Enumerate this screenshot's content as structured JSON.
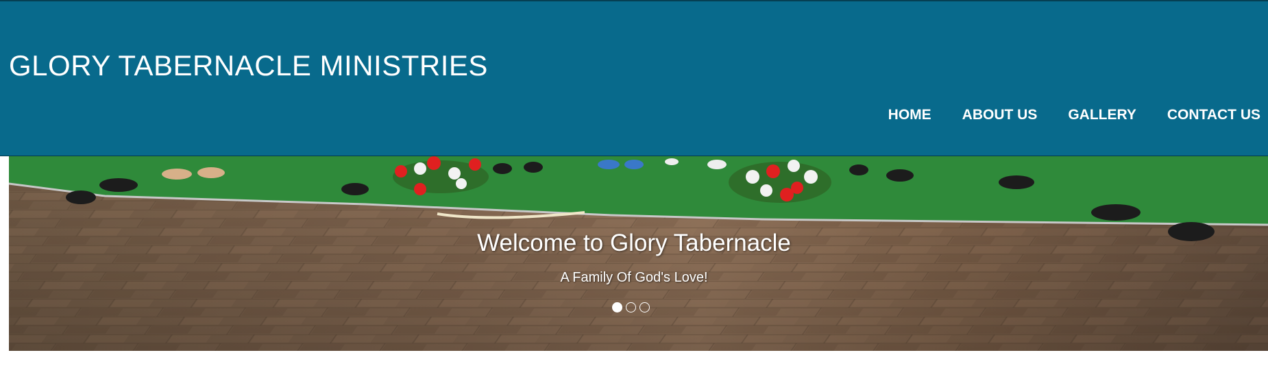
{
  "header": {
    "site_title": "GLORY TABERNACLE MINISTRIES",
    "background_color": "#086a8c",
    "nav": [
      {
        "label": "HOME"
      },
      {
        "label": "ABOUT US"
      },
      {
        "label": "GALLERY"
      },
      {
        "label": "CONTACT US"
      }
    ]
  },
  "hero": {
    "heading": "Welcome to Glory Tabernacle",
    "subheading": "A Family Of God's Love!",
    "slides_total": 3,
    "active_slide": 1
  }
}
